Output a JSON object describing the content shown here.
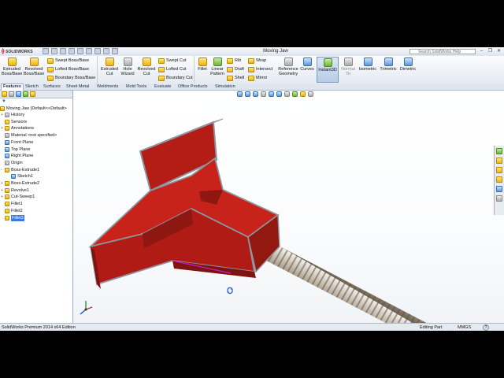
{
  "window": {
    "app_name": "SOLIDWORKS",
    "title": "Moving Jaw",
    "help_search_placeholder": "Search SolidWorks Help",
    "controls": [
      "–",
      "❐",
      "✕"
    ]
  },
  "ribbon": {
    "large_buttons": [
      {
        "label": "Extruded Boss/Base",
        "icon": "extruded-boss-icon"
      },
      {
        "label": "Revolved Boss/Base",
        "icon": "revolved-boss-icon"
      },
      {
        "label": "Extruded Cut",
        "icon": "extruded-cut-icon"
      },
      {
        "label": "Hole Wizard",
        "icon": "hole-wizard-icon"
      },
      {
        "label": "Revolved Cut",
        "icon": "revolved-cut-icon"
      },
      {
        "label": "Fillet",
        "icon": "fillet-icon"
      },
      {
        "label": "Linear Pattern",
        "icon": "linear-pattern-icon"
      },
      {
        "label": "Reference Geometry",
        "icon": "reference-geometry-icon"
      },
      {
        "label": "Curves",
        "icon": "curves-icon"
      },
      {
        "label": "Instant3D",
        "icon": "instant3d-icon"
      },
      {
        "label": "Normal To",
        "icon": "normal-to-icon"
      },
      {
        "label": "Isometric",
        "icon": "isometric-icon"
      },
      {
        "label": "Trimetric",
        "icon": "trimetric-icon"
      },
      {
        "label": "Dimetric",
        "icon": "dimetric-icon"
      }
    ],
    "small_buttons": [
      {
        "label": "Swept Boss/Base"
      },
      {
        "label": "Lofted Boss/Base"
      },
      {
        "label": "Boundary Boss/Base"
      },
      {
        "label": "Swept Cut"
      },
      {
        "label": "Lofted Cut"
      },
      {
        "label": "Boundary Cut"
      },
      {
        "label": "Rib"
      },
      {
        "label": "Draft"
      },
      {
        "label": "Shell"
      },
      {
        "label": "Wrap"
      },
      {
        "label": "Intersect"
      },
      {
        "label": "Mirror"
      }
    ]
  },
  "tabs": [
    "Features",
    "Sketch",
    "Surfaces",
    "Sheet Metal",
    "Weldments",
    "Mold Tools",
    "Evaluate",
    "Office Products",
    "Simulation"
  ],
  "active_tab": "Features",
  "feature_tree": {
    "root": "Moving Jaw  (Default<<Default>",
    "items": [
      {
        "label": "History",
        "indent": 1,
        "expander": "+"
      },
      {
        "label": "Sensors",
        "indent": 1,
        "expander": ""
      },
      {
        "label": "Annotations",
        "indent": 1,
        "expander": "+"
      },
      {
        "label": "Material <not specified>",
        "indent": 1,
        "expander": ""
      },
      {
        "label": "Front Plane",
        "indent": 1,
        "expander": ""
      },
      {
        "label": "Top Plane",
        "indent": 1,
        "expander": ""
      },
      {
        "label": "Right Plane",
        "indent": 1,
        "expander": ""
      },
      {
        "label": "Origin",
        "indent": 1,
        "expander": ""
      },
      {
        "label": "Boss-Extrude1",
        "indent": 1,
        "expander": "-"
      },
      {
        "label": "Sketch1",
        "indent": 2,
        "expander": ""
      },
      {
        "label": "Boss-Extrude2",
        "indent": 1,
        "expander": "+"
      },
      {
        "label": "Revolve1",
        "indent": 1,
        "expander": "+"
      },
      {
        "label": "Cut-Sweep1",
        "indent": 1,
        "expander": "+"
      },
      {
        "label": "Fillet1",
        "indent": 1,
        "expander": ""
      },
      {
        "label": "Fillet2",
        "indent": 1,
        "expander": ""
      },
      {
        "label": "Fillet3",
        "indent": 1,
        "expander": "",
        "selected": true
      }
    ]
  },
  "status": {
    "edition": "SolidWorks Premium 2014 x64 Edition",
    "mode": "Editing Part",
    "units": "MMGS",
    "help": "?"
  },
  "colors": {
    "part_red": "#c8231b",
    "part_edge": "#9aa3ad",
    "thread": "#c8bfb3",
    "selected_edge": "#d11ad1"
  }
}
